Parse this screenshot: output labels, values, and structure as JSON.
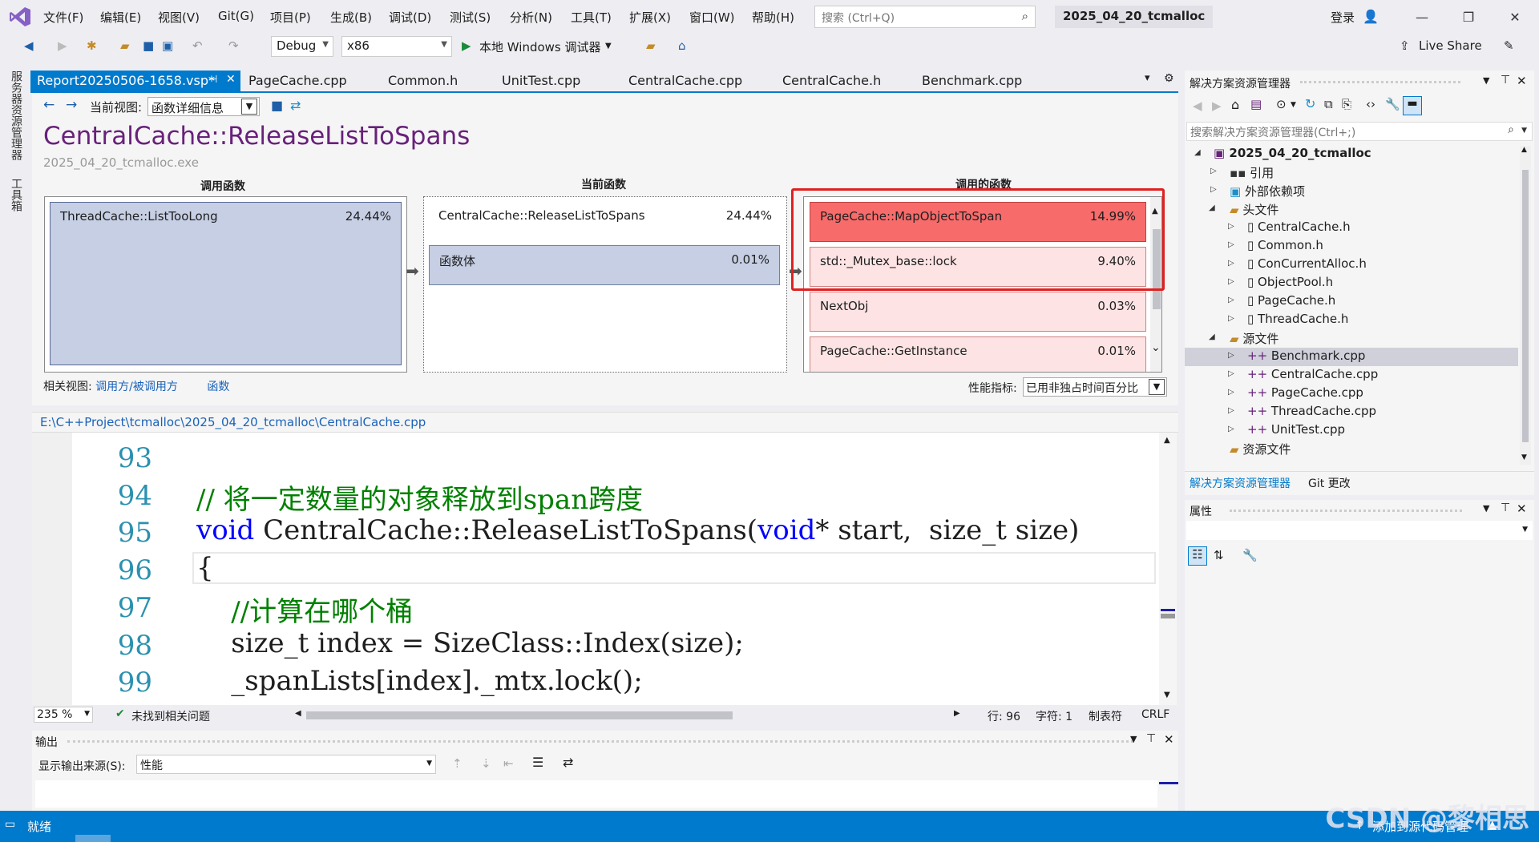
{
  "window": {
    "menu": [
      "文件(F)",
      "编辑(E)",
      "视图(V)",
      "Git(G)",
      "项目(P)",
      "生成(B)",
      "调试(D)",
      "测试(S)",
      "分析(N)",
      "工具(T)",
      "扩展(X)",
      "窗口(W)",
      "帮助(H)"
    ],
    "search_placeholder": "搜索 (Ctrl+Q)",
    "solution_title": "2025_04_20_tcmalloc",
    "login": "登录"
  },
  "toolbar": {
    "config": "Debug",
    "platform": "x86",
    "debugger": "本地 Windows 调试器",
    "live_share": "Live Share"
  },
  "left_strip": [
    "服务器资源管理器",
    "工具箱"
  ],
  "tabs": [
    "Report20250506-1658.vsp*",
    "PageCache.cpp",
    "Common.h",
    "UnitTest.cpp",
    "CentralCache.cpp",
    "CentralCache.h",
    "Benchmark.cpp"
  ],
  "report": {
    "view_label": "当前视图:",
    "view_value": "函数详细信息",
    "function_title": "CentralCache::ReleaseListToSpans",
    "exe": "2025_04_20_tcmalloc.exe",
    "col_callers": "调用函数",
    "col_current": "当前函数",
    "col_callees": "调用的函数",
    "callers": [
      {
        "name": "ThreadCache::ListTooLong",
        "pct": "24.44%"
      }
    ],
    "current": {
      "name": "CentralCache::ReleaseListToSpans",
      "pct": "24.44%",
      "body_name": "函数体",
      "body_pct": "0.01%"
    },
    "callees": [
      {
        "name": "PageCache::MapObjectToSpan",
        "pct": "14.99%"
      },
      {
        "name": "std::_Mutex_base::lock",
        "pct": "9.40%"
      },
      {
        "name": "NextObj",
        "pct": "0.03%"
      },
      {
        "name": "PageCache::GetInstance",
        "pct": "0.01%"
      }
    ],
    "related_label": "相关视图:",
    "related_link1": "调用方/被调用方",
    "related_link2": "函数",
    "metric_label": "性能指标:",
    "metric_value": "已用非独占时间百分比"
  },
  "editor": {
    "path": "E:\\C++Project\\tcmalloc\\2025_04_20_tcmalloc\\CentralCache.cpp",
    "zoom": "235 %",
    "issues": "未找到相关问题",
    "line": "行: 96",
    "char": "字符: 1",
    "tab": "制表符",
    "eol": "CRLF",
    "lines": [
      {
        "n": "93",
        "text": ""
      },
      {
        "n": "94",
        "text": "// 将一定数量的对象释放到span跨度"
      },
      {
        "n": "95",
        "kw": "void",
        "text": " CentralCache::ReleaseListToSpans(",
        "kw2": "void",
        "text2": "* start,  size_t size)"
      },
      {
        "n": "96",
        "text": "{"
      },
      {
        "n": "97",
        "text": "    //计算在哪个桶"
      },
      {
        "n": "98",
        "text": "    size_t index = SizeClass::Index(size);"
      },
      {
        "n": "99",
        "text": "    _spanLists[index]._mtx.lock();"
      }
    ]
  },
  "output": {
    "title": "输出",
    "source_label": "显示输出来源(S):",
    "source_value": "性能"
  },
  "solution_explorer": {
    "title": "解决方案资源管理器",
    "search_placeholder": "搜索解决方案资源管理器(Ctrl+;)",
    "root": "2025_04_20_tcmalloc",
    "references": "引用",
    "external_deps": "外部依赖项",
    "headers_folder": "头文件",
    "headers": [
      "CentralCache.h",
      "Common.h",
      "ConCurrentAlloc.h",
      "ObjectPool.h",
      "PageCache.h",
      "ThreadCache.h"
    ],
    "sources_folder": "源文件",
    "sources": [
      "Benchmark.cpp",
      "CentralCache.cpp",
      "PageCache.cpp",
      "ThreadCache.cpp",
      "UnitTest.cpp"
    ],
    "resources_folder": "资源文件",
    "tab1": "解决方案资源管理器",
    "tab2": "Git 更改"
  },
  "properties": {
    "title": "属性"
  },
  "status": {
    "ready": "就绪",
    "right": "添加到源代码管理"
  },
  "watermark": "CSDN @黎相思",
  "colors": {
    "accent": "#007acc",
    "title_purple": "#68217a",
    "hot": "#f86b6b",
    "callee_bg": "#fde3e3",
    "caller_bg": "#c6cfe3",
    "highlight_frame": "#e02020"
  }
}
